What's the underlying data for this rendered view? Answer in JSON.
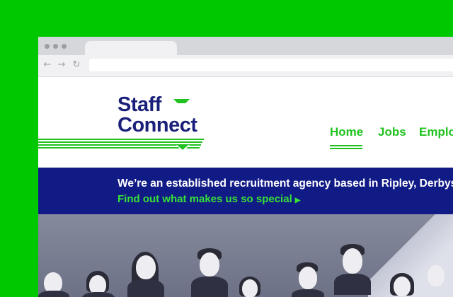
{
  "logo": {
    "line1": "Staff",
    "line2": "Connect"
  },
  "nav": {
    "items": [
      {
        "label": "Home",
        "active": true
      },
      {
        "label": "Jobs",
        "active": false
      },
      {
        "label": "Emplo",
        "active": false
      }
    ]
  },
  "banner": {
    "title": "We’re an established recruitment agency based in Ripley, Derbyshire",
    "link": "Find out what makes us so special"
  },
  "colors": {
    "background": "#00c800",
    "brand_navy": "#1a1f7a",
    "brand_green": "#1fc21f",
    "banner_bg": "#111b86"
  },
  "icons": [
    "back-arrow-icon",
    "forward-arrow-icon",
    "reload-icon",
    "chevron-right-icon"
  ]
}
